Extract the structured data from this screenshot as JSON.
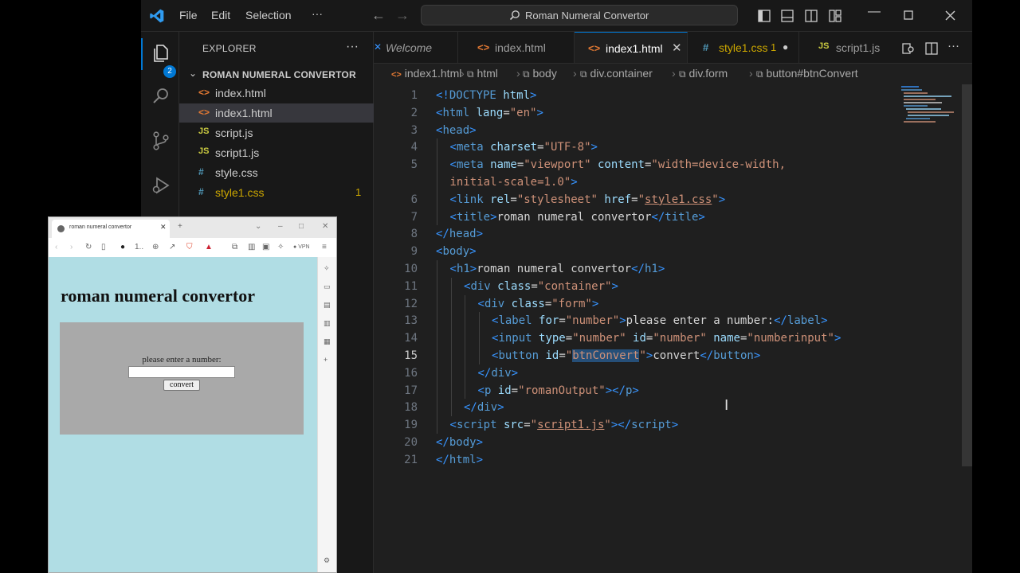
{
  "titlebar": {
    "menu": [
      "File",
      "Edit",
      "Selection",
      "···"
    ],
    "search": "Roman Numeral Convertor"
  },
  "activity": {
    "badge": "2"
  },
  "explorer": {
    "title": "EXPLORER",
    "folder": "ROMAN NUMERAL CONVERTOR",
    "files": [
      {
        "icon": "<>",
        "name": "index.html"
      },
      {
        "icon": "<>",
        "name": "index1.html"
      },
      {
        "icon": "JS",
        "name": "script.js"
      },
      {
        "icon": "JS",
        "name": "script1.js"
      },
      {
        "icon": "#",
        "name": "style.css"
      },
      {
        "icon": "#",
        "name": "style1.css",
        "badge": "1"
      }
    ]
  },
  "tabs": [
    {
      "label": "Welcome"
    },
    {
      "label": "index.html"
    },
    {
      "label": "index1.html"
    },
    {
      "label": "style1.css",
      "badge": "1"
    },
    {
      "label": "script1.js"
    }
  ],
  "breadcrumb": [
    "index1.html",
    "html",
    "body",
    "div.container",
    "div.form",
    "button#btnConvert"
  ],
  "code": {
    "current_line": 15,
    "line_numbers": [
      "1",
      "2",
      "3",
      "4",
      "5",
      "",
      "6",
      "7",
      "8",
      "9",
      "10",
      "11",
      "12",
      "13",
      "14",
      "15",
      "16",
      "17",
      "18",
      "19",
      "20",
      "21"
    ],
    "lines": [
      {
        "indent": 0,
        "t": [
          [
            "tag",
            "<!"
          ],
          [
            "tn",
            "DOCTYPE"
          ],
          [
            "at",
            " html"
          ],
          [
            "tag",
            ">"
          ]
        ]
      },
      {
        "indent": 0,
        "t": [
          [
            "tag",
            "<"
          ],
          [
            "tn",
            "html"
          ],
          [
            "at",
            " lang"
          ],
          [
            "tx",
            "="
          ],
          [
            "st",
            "\"en\""
          ],
          [
            "tag",
            ">"
          ]
        ]
      },
      {
        "indent": 0,
        "t": [
          [
            "tag",
            "<"
          ],
          [
            "tn",
            "head"
          ],
          [
            "tag",
            ">"
          ]
        ]
      },
      {
        "indent": 1,
        "t": [
          [
            "tag",
            "<"
          ],
          [
            "tn",
            "meta"
          ],
          [
            "at",
            " charset"
          ],
          [
            "tx",
            "="
          ],
          [
            "st",
            "\"UTF-8\""
          ],
          [
            "tag",
            ">"
          ]
        ]
      },
      {
        "indent": 1,
        "t": [
          [
            "tag",
            "<"
          ],
          [
            "tn",
            "meta"
          ],
          [
            "at",
            " name"
          ],
          [
            "tx",
            "="
          ],
          [
            "st",
            "\"viewport\""
          ],
          [
            "at",
            " content"
          ],
          [
            "tx",
            "="
          ],
          [
            "st",
            "\"width=device-width,"
          ]
        ]
      },
      {
        "indent": 1,
        "t": [
          [
            "st",
            "initial-scale=1.0\""
          ],
          [
            "tag",
            ">"
          ]
        ]
      },
      {
        "indent": 1,
        "t": [
          [
            "tag",
            "<"
          ],
          [
            "tn",
            "link"
          ],
          [
            "at",
            " rel"
          ],
          [
            "tx",
            "="
          ],
          [
            "st",
            "\"stylesheet\""
          ],
          [
            "at",
            " href"
          ],
          [
            "tx",
            "="
          ],
          [
            "st",
            "\""
          ],
          [
            "stu",
            "style1.css"
          ],
          [
            "st",
            "\""
          ],
          [
            "tag",
            ">"
          ]
        ]
      },
      {
        "indent": 1,
        "t": [
          [
            "tag",
            "<"
          ],
          [
            "tn",
            "title"
          ],
          [
            "tag",
            ">"
          ],
          [
            "tx",
            "roman numeral convertor"
          ],
          [
            "tag",
            "</"
          ],
          [
            "tn",
            "title"
          ],
          [
            "tag",
            ">"
          ]
        ]
      },
      {
        "indent": 0,
        "t": [
          [
            "tag",
            "</"
          ],
          [
            "tn",
            "head"
          ],
          [
            "tag",
            ">"
          ]
        ]
      },
      {
        "indent": 0,
        "t": [
          [
            "tag",
            "<"
          ],
          [
            "tn",
            "body"
          ],
          [
            "tag",
            ">"
          ]
        ]
      },
      {
        "indent": 1,
        "t": [
          [
            "tag",
            "<"
          ],
          [
            "tn",
            "h1"
          ],
          [
            "tag",
            ">"
          ],
          [
            "tx",
            "roman numeral convertor"
          ],
          [
            "tag",
            "</"
          ],
          [
            "tn",
            "h1"
          ],
          [
            "tag",
            ">"
          ]
        ]
      },
      {
        "indent": 2,
        "t": [
          [
            "tag",
            "<"
          ],
          [
            "tn",
            "div"
          ],
          [
            "at",
            " class"
          ],
          [
            "tx",
            "="
          ],
          [
            "st",
            "\"container\""
          ],
          [
            "tag",
            ">"
          ]
        ]
      },
      {
        "indent": 3,
        "t": [
          [
            "tag",
            "<"
          ],
          [
            "tn",
            "div"
          ],
          [
            "at",
            " class"
          ],
          [
            "tx",
            "="
          ],
          [
            "st",
            "\"form\""
          ],
          [
            "tag",
            ">"
          ]
        ]
      },
      {
        "indent": 4,
        "t": [
          [
            "tag",
            "<"
          ],
          [
            "tn",
            "label"
          ],
          [
            "at",
            " for"
          ],
          [
            "tx",
            "="
          ],
          [
            "st",
            "\"number\""
          ],
          [
            "tag",
            ">"
          ],
          [
            "tx",
            "please enter a number:"
          ],
          [
            "tag",
            "</"
          ],
          [
            "tn",
            "label"
          ],
          [
            "tag",
            ">"
          ]
        ]
      },
      {
        "indent": 4,
        "t": [
          [
            "tag",
            "<"
          ],
          [
            "tn",
            "input"
          ],
          [
            "at",
            " type"
          ],
          [
            "tx",
            "="
          ],
          [
            "st",
            "\"number\""
          ],
          [
            "at",
            " id"
          ],
          [
            "tx",
            "="
          ],
          [
            "st",
            "\"number\""
          ],
          [
            "at",
            " name"
          ],
          [
            "tx",
            "="
          ],
          [
            "st",
            "\"numberinput\""
          ],
          [
            "tag",
            ">"
          ]
        ]
      },
      {
        "indent": 4,
        "t": [
          [
            "tag",
            "<"
          ],
          [
            "tn",
            "button"
          ],
          [
            "at",
            " id"
          ],
          [
            "tx",
            "="
          ],
          [
            "st",
            "\""
          ],
          [
            "sts",
            "btnConvert"
          ],
          [
            "st",
            "\""
          ],
          [
            "tag",
            ">"
          ],
          [
            "tx",
            "convert"
          ],
          [
            "tag",
            "</"
          ],
          [
            "tn",
            "button"
          ],
          [
            "tag",
            ">"
          ]
        ]
      },
      {
        "indent": 3,
        "t": [
          [
            "tag",
            "</"
          ],
          [
            "tn",
            "div"
          ],
          [
            "tag",
            ">"
          ]
        ]
      },
      {
        "indent": 3,
        "t": [
          [
            "tag",
            "<"
          ],
          [
            "tn",
            "p"
          ],
          [
            "at",
            " id"
          ],
          [
            "tx",
            "="
          ],
          [
            "st",
            "\"romanOutput\""
          ],
          [
            "tag",
            "></"
          ],
          [
            "tn",
            "p"
          ],
          [
            "tag",
            ">"
          ]
        ]
      },
      {
        "indent": 2,
        "t": [
          [
            "tag",
            "</"
          ],
          [
            "tn",
            "div"
          ],
          [
            "tag",
            ">"
          ]
        ]
      },
      {
        "indent": 1,
        "t": [
          [
            "tag",
            "<"
          ],
          [
            "tn",
            "script"
          ],
          [
            "at",
            " src"
          ],
          [
            "tx",
            "="
          ],
          [
            "st",
            "\""
          ],
          [
            "stu",
            "script1.js"
          ],
          [
            "st",
            "\""
          ],
          [
            "tag",
            "></"
          ],
          [
            "tn",
            "script"
          ],
          [
            "tag",
            ">"
          ]
        ]
      },
      {
        "indent": 0,
        "t": [
          [
            "tag",
            "</"
          ],
          [
            "tn",
            "body"
          ],
          [
            "tag",
            ">"
          ]
        ]
      },
      {
        "indent": 0,
        "t": [
          [
            "tag",
            "</"
          ],
          [
            "tn",
            "html"
          ],
          [
            "tag",
            ">"
          ]
        ]
      }
    ]
  },
  "browser": {
    "tab_title": "roman numeral convertor",
    "heading": "roman numeral convertor",
    "label": "please enter a number:",
    "button": "convert",
    "vpn": "VPN"
  },
  "colors": {
    "accent": "#0078d4",
    "page_bg": "#b0dde4",
    "form_bg": "#a9a9a9",
    "modified": "#cca700"
  }
}
